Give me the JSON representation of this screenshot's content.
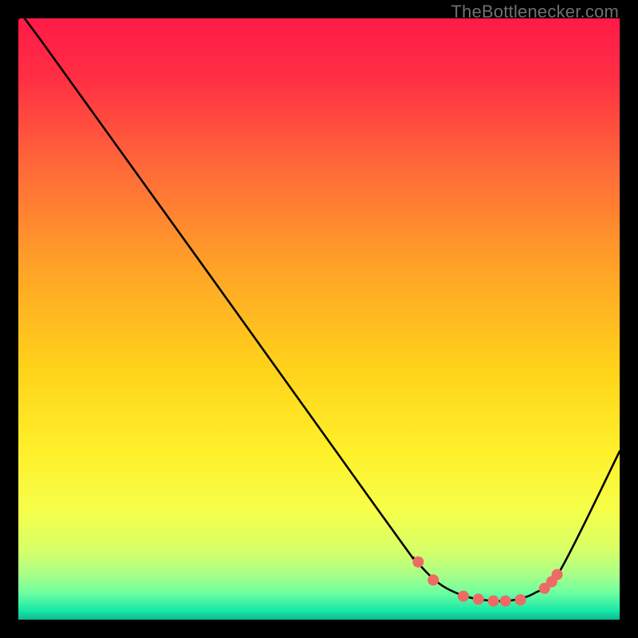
{
  "watermark": "TheBottlenecker.com",
  "chart_data": {
    "type": "line",
    "title": "",
    "xlabel": "",
    "ylabel": "",
    "xlim": [
      0,
      100
    ],
    "ylim": [
      0,
      100
    ],
    "series": [
      {
        "name": "bottleneck-curve",
        "x": [
          0,
          4,
          60,
          66,
          70,
          74,
          78,
          82,
          86,
          90,
          100
        ],
        "y": [
          100,
          96,
          18,
          10,
          6,
          4,
          3.2,
          3.2,
          4.5,
          8,
          28
        ]
      }
    ],
    "markers": {
      "name": "highlighted-points",
      "x": [
        66.5,
        69,
        74,
        76.5,
        79,
        81,
        83.5,
        87.5,
        88.7,
        89.6
      ],
      "y": [
        9.6,
        6.6,
        3.9,
        3.4,
        3.1,
        3.1,
        3.3,
        5.2,
        6.3,
        7.5
      ],
      "color": "#ee6a65",
      "radius": 7
    },
    "gradient_stops": [
      {
        "offset": 0.0,
        "color": "#ff1a47"
      },
      {
        "offset": 0.1,
        "color": "#ff2f44"
      },
      {
        "offset": 0.25,
        "color": "#ff6a38"
      },
      {
        "offset": 0.42,
        "color": "#ffa427"
      },
      {
        "offset": 0.58,
        "color": "#ffd21a"
      },
      {
        "offset": 0.72,
        "color": "#fff02a"
      },
      {
        "offset": 0.82,
        "color": "#f5ff4a"
      },
      {
        "offset": 0.885,
        "color": "#d7ff68"
      },
      {
        "offset": 0.925,
        "color": "#a9ff87"
      },
      {
        "offset": 0.955,
        "color": "#6fffa0"
      },
      {
        "offset": 0.985,
        "color": "#18e8a8"
      },
      {
        "offset": 1.0,
        "color": "#0fb88e"
      }
    ]
  }
}
